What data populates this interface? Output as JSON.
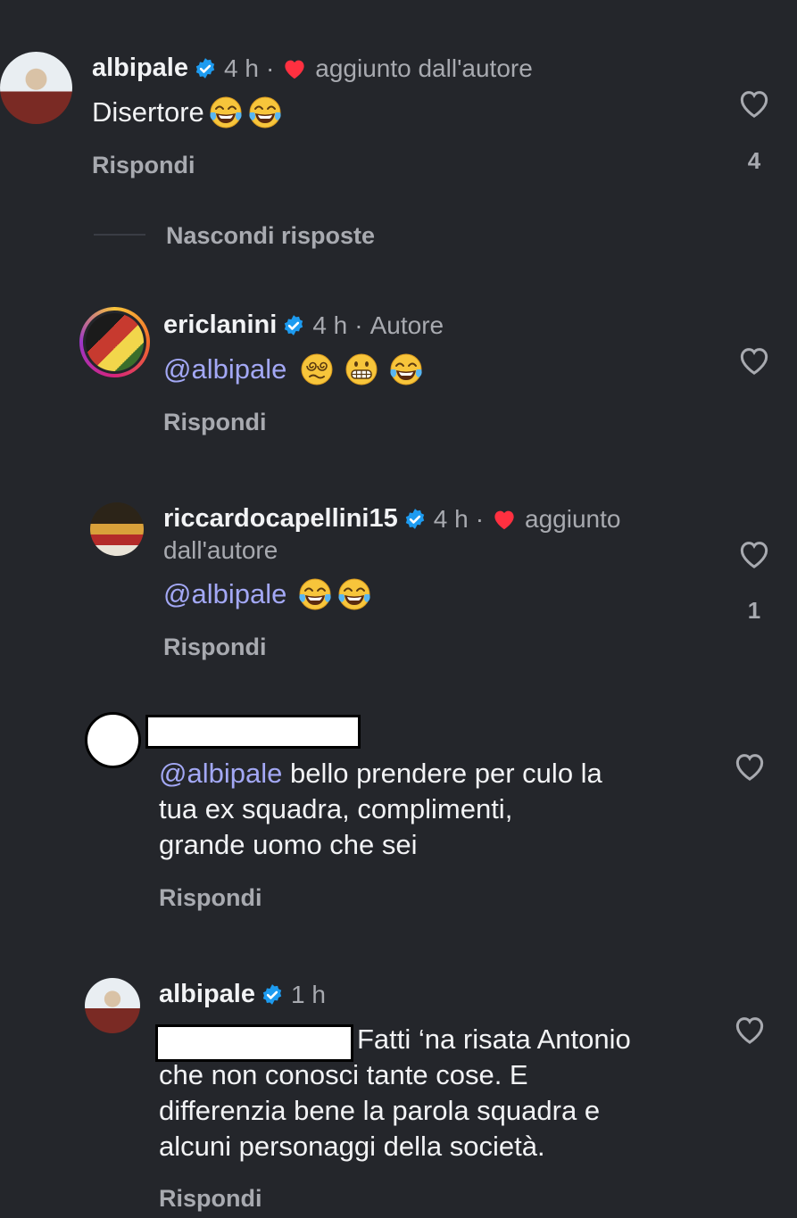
{
  "thread": {
    "hide_replies_label": "Nascondi risposte",
    "comments": [
      {
        "username": "albipale",
        "time": "4 h",
        "separator": "·",
        "tag": "aggiunto dall'autore",
        "text": "Disertore",
        "reply": "Rispondi",
        "likes": "4"
      },
      {
        "username": "ericlanini",
        "time": "4 h",
        "separator": "·",
        "tag": "Autore",
        "mention": "@albipale",
        "reply": "Rispondi"
      },
      {
        "username": "riccardocapellini15",
        "time": "4 h",
        "separator": "·",
        "tag_line1": "aggiunto",
        "tag_line2": "dall'autore",
        "mention": "@albipale",
        "reply": "Rispondi",
        "likes": "1"
      },
      {
        "mention": "@albipale",
        "text_line1": " bello prendere per culo la",
        "text_line2": "tua ex squadra, complimenti,",
        "text_line3": "grande uomo che sei",
        "reply": "Rispondi"
      },
      {
        "username": "albipale",
        "time": "1 h",
        "text_line1": "Fatti ‘na risata Antonio",
        "text_line2": "che non conosci tante cose. E",
        "text_line3": "differenzia bene  la parola squadra e",
        "text_line4": "alcuni personaggi della società.",
        "reply": "Rispondi"
      }
    ]
  },
  "icons": {
    "verified": "verified-badge-icon",
    "liked_by_author": "red-heart-icon",
    "like": "heart-outline-icon",
    "emoji_laugh": "face-with-tears-of-joy-icon",
    "emoji_dizzy": "face-with-spiral-eyes-icon",
    "emoji_grimace": "grimacing-face-icon"
  },
  "colors": {
    "background": "#24262b",
    "text": "#f2f3f5",
    "muted": "#a8aab0",
    "mention": "#a3a8f5",
    "verified": "#1d9bf0",
    "heart": "#ff3040"
  }
}
